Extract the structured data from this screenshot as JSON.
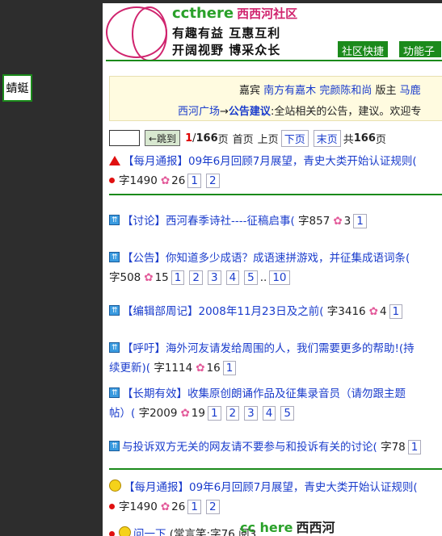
{
  "left_tab": {
    "label": "蜻蜓"
  },
  "header": {
    "brand_en": "ccthere",
    "brand_cn": "西西河社区",
    "slogan1": "有趣有益 互惠互利",
    "slogan2": "开阔视野 博采众长",
    "quick_btn": "社区快捷",
    "sub_btn": "功能子菜"
  },
  "info": {
    "row1": [
      "嘉宾",
      "南方有嘉木",
      "完颜陈和尚",
      "版主",
      "马鹿"
    ],
    "breadcrumb_home": "西河广场",
    "arrow": "→",
    "forum": "公告建议",
    "forum_desc": ":全站相关的公告，建议。欢迎专"
  },
  "pager": {
    "jump_label": "←跳到",
    "current": "1",
    "slash": "/",
    "pages": "166",
    "page_unit": "页",
    "first": "首页",
    "prev": "上页",
    "next": "下页",
    "last": "末页",
    "total_prefix": "共",
    "total": "166",
    "total_suffix": "页"
  },
  "threads": [
    {
      "title": "【每月通报】09年6月回顾7月展望，青史大类开始认证规则(",
      "line2_prefix": "字1490",
      "flowers": "26",
      "pages": [
        "1",
        "2"
      ]
    },
    {
      "title": "【讨论】西河春季诗社----征稿启事(",
      "tail": " 字857",
      "flowers": "3",
      "pages": [
        "1"
      ]
    },
    {
      "title": "【公告】你知道多少成语？成语速拼游戏，并征集成语词条(",
      "line2_prefix": "字508",
      "flowers": "15",
      "pages": [
        "1",
        "2",
        "3",
        "4",
        "5"
      ],
      "ellipsis": "..",
      "last_page": "10"
    },
    {
      "title": "【编辑部周记】2008年11月23日及之前(",
      "tail": " 字3416",
      "flowers": "4",
      "pages": [
        "1"
      ]
    },
    {
      "title": "【呼吁】海外河友请发给周围的人，我们需要更多的帮助!(持",
      "line2_text": "续更新)(",
      "line2_prefix": " 字1114",
      "flowers": "16",
      "pages": [
        "1"
      ]
    },
    {
      "title": "【长期有效】收集原创朗诵作品及征集录音员（请勿跟主题",
      "line2_text": "帖）(",
      "line2_prefix": " 字2009",
      "flowers": "19",
      "pages": [
        "1",
        "2",
        "3",
        "4",
        "5"
      ]
    },
    {
      "title": "与投诉双方无关的网友请不要参与和投诉有关的讨论(",
      "tail": " 字78",
      "pages": [
        "1"
      ]
    },
    {
      "title": "【每月通报】09年6月回顾7月展望，青史大类开始认证规则(",
      "line2_prefix": "字1490",
      "flowers": "26",
      "pages": [
        "1",
        "2"
      ]
    },
    {
      "title": "问一下",
      "tail": " (常言笑:字76 阅3"
    }
  ],
  "flower_icon": "✿",
  "footer": {
    "brand_en": "cc here",
    "brand_cn": "西西河"
  },
  "colors": {
    "accent_green": "#1b8a1b",
    "brand_pink": "#d0246e",
    "link_blue": "#1a3ccc"
  }
}
